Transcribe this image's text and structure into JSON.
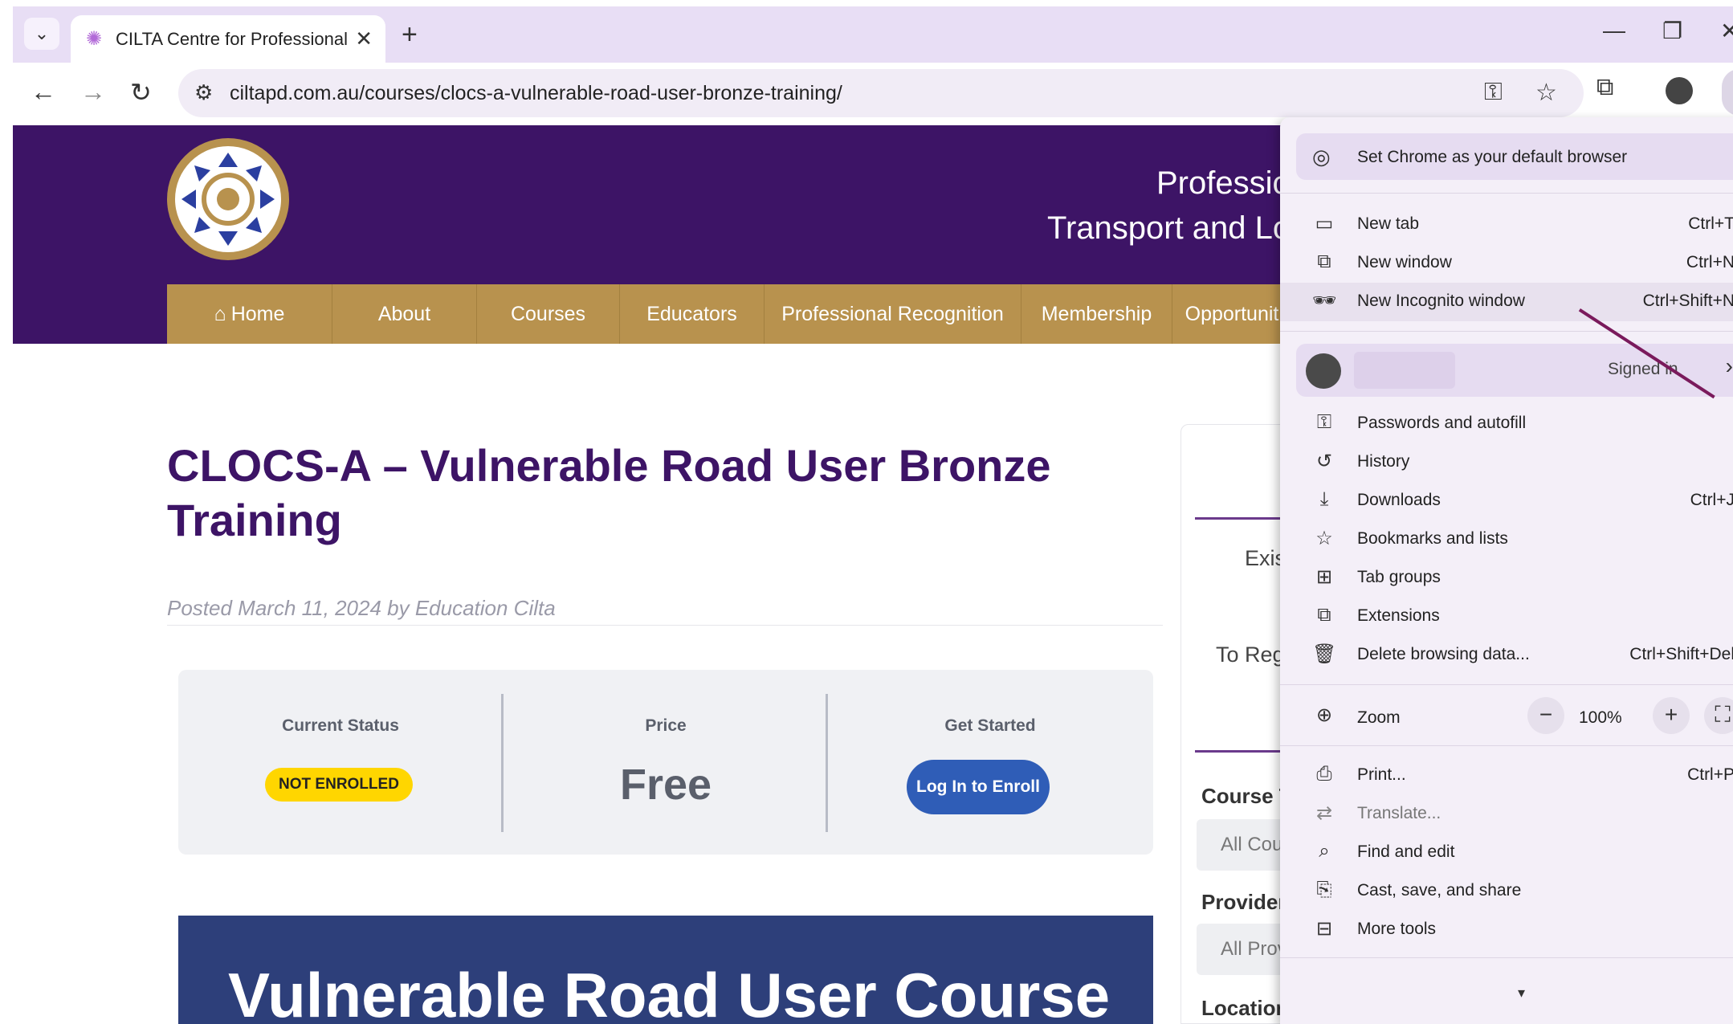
{
  "browser": {
    "tab_title": "CILTA Centre for Professional D",
    "url": "ciltapd.com.au/courses/clocs-a-vulnerable-road-user-bronze-training/"
  },
  "site": {
    "tagline_line1": "Professic",
    "tagline_line2": "Transport and Lo",
    "nav": [
      "Home",
      "About",
      "Courses",
      "Educators",
      "Professional Recognition",
      "Membership",
      "Opportunit"
    ]
  },
  "post": {
    "title": "CLOCS-A – Vulnerable Road User Bronze Training",
    "meta": "Posted March 11, 2024 by Education Cilta"
  },
  "status_box": {
    "current_status_label": "Current Status",
    "status_badge": "NOT ENROLLED",
    "price_label": "Price",
    "price_value": "Free",
    "get_started_label": "Get Started",
    "enroll_button": "Log In to Enroll"
  },
  "banner": {
    "text": "Vulnerable Road User Course"
  },
  "sidebar": {
    "text_existing": "Exis",
    "text_register": "To Reg",
    "course_type_head": "Course T",
    "course_type_select": "All Cou",
    "provider_head": "Provider",
    "provider_select": "All Prov",
    "location_head": "Location"
  },
  "chrome_menu": {
    "set_default": "Set Chrome as your default browser",
    "new_tab": {
      "label": "New tab",
      "shortcut": "Ctrl+T"
    },
    "new_window": {
      "label": "New window",
      "shortcut": "Ctrl+N"
    },
    "new_incognito": {
      "label": "New Incognito window",
      "shortcut": "Ctrl+Shift+N"
    },
    "signed_in": "Signed in",
    "passwords": "Passwords and autofill",
    "history": "History",
    "downloads": {
      "label": "Downloads",
      "shortcut": "Ctrl+J"
    },
    "bookmarks": "Bookmarks and lists",
    "tab_groups": "Tab groups",
    "extensions": "Extensions",
    "delete_data": {
      "label": "Delete browsing data...",
      "shortcut": "Ctrl+Shift+Del"
    },
    "zoom": {
      "label": "Zoom",
      "value": "100%"
    },
    "print": {
      "label": "Print...",
      "shortcut": "Ctrl+P"
    },
    "translate": "Translate...",
    "find_edit": "Find and edit",
    "cast_save": "Cast, save, and share",
    "more_tools": "More tools"
  },
  "colors": {
    "header_purple": "#3d1466",
    "nav_gold": "#b8924e",
    "enroll_blue": "#2f5db7",
    "badge_yellow": "#ffd600"
  }
}
